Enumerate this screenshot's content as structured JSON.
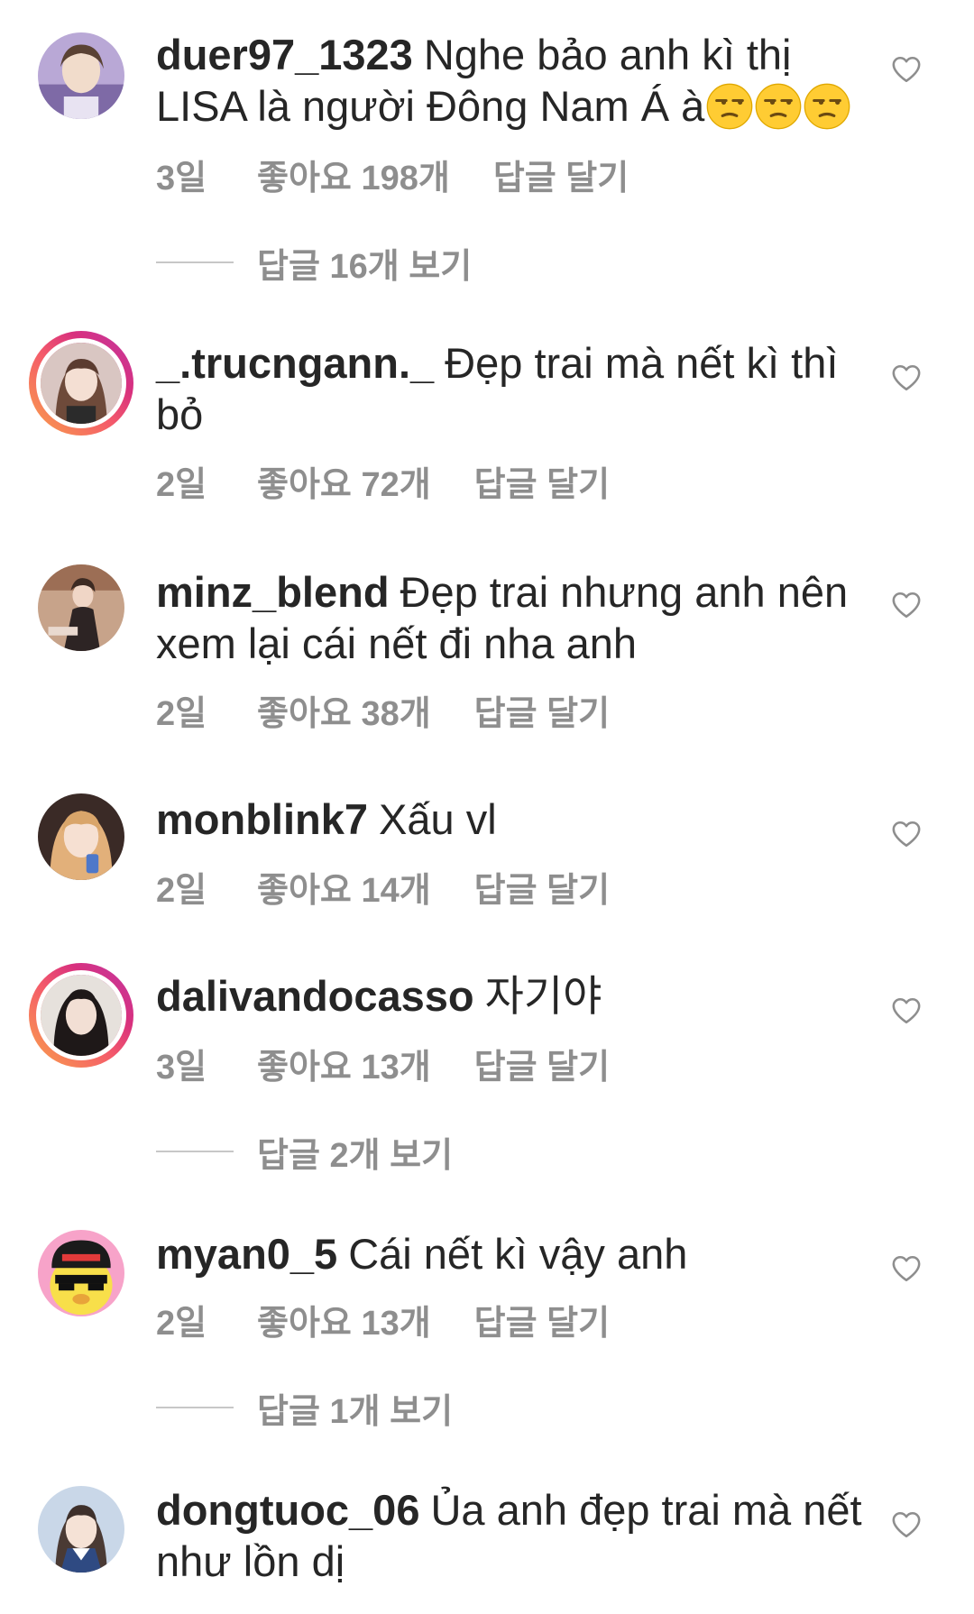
{
  "comments": [
    {
      "username": "duer97_1323",
      "text": "Nghe bảo anh kì thị LISA là người Đông Nam Á à",
      "emojis": [
        "unamused-face",
        "unamused-face",
        "unamused-face"
      ],
      "time": "3일",
      "likes": "좋아요 198개",
      "reply": "답글 달기",
      "story_ring": false,
      "view_replies": "답글 16개 보기"
    },
    {
      "username": "_.trucngann._",
      "text": "Đẹp trai mà nết kì thì bỏ",
      "time": "2일",
      "likes": "좋아요 72개",
      "reply": "답글 달기",
      "story_ring": true
    },
    {
      "username": "minz_blend",
      "text": "Đẹp trai nhưng anh nên xem lại cái nết đi nha anh",
      "time": "2일",
      "likes": "좋아요 38개",
      "reply": "답글 달기",
      "story_ring": false
    },
    {
      "username": "monblink7",
      "text": "Xấu vl",
      "time": "2일",
      "likes": "좋아요 14개",
      "reply": "답글 달기",
      "story_ring": false
    },
    {
      "username": "dalivandocasso",
      "text": "자기야",
      "time": "3일",
      "likes": "좋아요 13개",
      "reply": "답글 달기",
      "story_ring": true,
      "view_replies": "답글 2개 보기"
    },
    {
      "username": "myan0_5",
      "text": "Cái nết kì vậy anh",
      "time": "2일",
      "likes": "좋아요 13개",
      "reply": "답글 달기",
      "story_ring": false,
      "view_replies": "답글 1개 보기"
    },
    {
      "username": "dongtuoc_06",
      "text": "Ủa anh đẹp trai mà nết như lồn dị",
      "time": "",
      "likes": "",
      "reply": "",
      "story_ring": false
    }
  ],
  "icons": {
    "like": "heart-outline-icon",
    "emoji": "unamused-face-emoji"
  },
  "colors": {
    "text": "#262626",
    "secondary": "#8e8e8e",
    "divider": "#c7c7c7",
    "story_ring_start": "#f9a24a",
    "story_ring_end": "#c13aa4"
  }
}
